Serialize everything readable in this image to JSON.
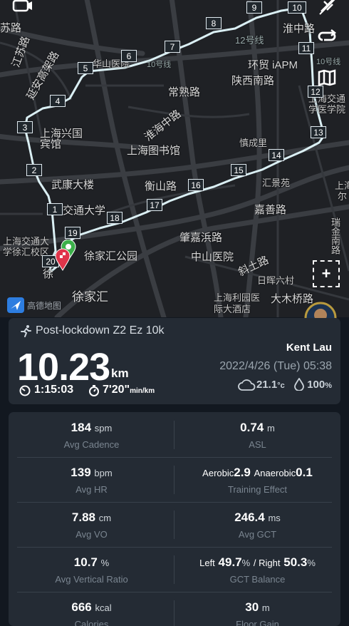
{
  "map": {
    "labels": [
      "华山医院",
      "常熟路",
      "陕西南路",
      "环贸 iAPM",
      "淮海中路",
      "上海图书馆",
      "慎成里",
      "武康大楼",
      "衡山路",
      "汇景苑",
      "嘉善路",
      "交通大学",
      "上海交通大",
      "学徐汇校区",
      "徐家汇公园",
      "肇嘉浜路",
      "中山医院",
      "斜土路",
      "日晖六村",
      "徐家汇",
      "上海利园医",
      "际大酒店",
      "大木桥路",
      "上海交通",
      "学医学院",
      "瑞金南路",
      "上海兴国",
      "宾馆",
      "12号线",
      "10号线",
      "10号线",
      "延安高架路",
      "江苏路",
      "苏路",
      "淮中路",
      "徐",
      "尔",
      "上海"
    ],
    "km_markers": [
      "1",
      "2",
      "3",
      "4",
      "5",
      "6",
      "7",
      "8",
      "9",
      "10",
      "11",
      "12",
      "13",
      "14",
      "15",
      "16",
      "17",
      "18",
      "19",
      "20"
    ],
    "attribution": "高德地图",
    "zoom_button": "+",
    "route_color": "#dff7fb"
  },
  "summary": {
    "title": "Post-lockdown Z2 Ez 10k",
    "user_name": "Kent Lau",
    "distance": "10.23",
    "distance_unit": "km",
    "duration": "1:15:03",
    "pace": "7'20\"",
    "pace_unit": "min/km",
    "date": "2022/4/26 (Tue) 05:38",
    "temperature": "21.1",
    "temperature_unit": "°c",
    "humidity": "100",
    "humidity_unit": "%"
  },
  "stats": {
    "cadence": {
      "value": "184",
      "unit": "spm",
      "label": "Avg Cadence"
    },
    "asl": {
      "value": "0.74",
      "unit": "m",
      "label": "ASL"
    },
    "hr": {
      "value": "139",
      "unit": "bpm",
      "label": "Avg HR"
    },
    "training_effect": {
      "aerobic_label": "Aerobic",
      "aerobic": "2.9",
      "anaerobic_label": "Anaerobic",
      "anaerobic": "0.1",
      "label": "Training Effect"
    },
    "vo": {
      "value": "7.88",
      "unit": "cm",
      "label": "Avg VO"
    },
    "gct": {
      "value": "246.4",
      "unit": "ms",
      "label": "Avg GCT"
    },
    "vertical_ratio": {
      "value": "10.7",
      "unit": "%",
      "label": "Avg Vertical Ratio"
    },
    "gct_balance": {
      "left_label": "Left",
      "left": "49.7",
      "right_label": "/ Right",
      "right": "50.3",
      "unit": "%",
      "label": "GCT Balance"
    },
    "calories": {
      "value": "666",
      "unit": "kcal",
      "label": "Calories"
    },
    "floor_gain": {
      "value": "30",
      "unit": "m",
      "label": "Floor Gain"
    }
  }
}
